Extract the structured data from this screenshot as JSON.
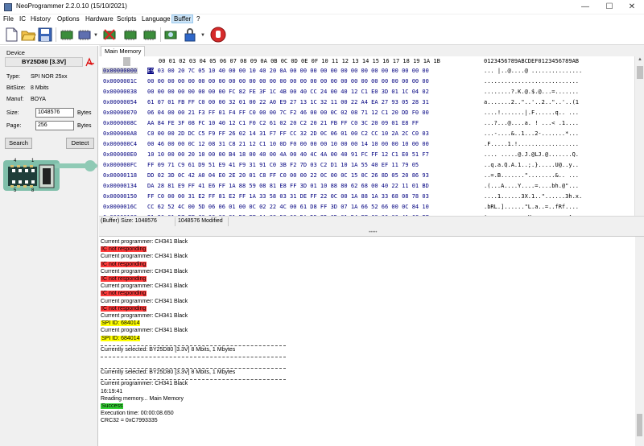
{
  "window": {
    "title": "NeoProgrammer 2.2.0.10 (15/10/2021)",
    "controls": [
      "—",
      "☐",
      "✕"
    ]
  },
  "menu": [
    "File",
    "IC",
    "History",
    "Options",
    "Hardware",
    "Scripts",
    "Language",
    "Buffer",
    "?"
  ],
  "menu_selected": "Buffer",
  "toolbar_icons": [
    "new-file-icon",
    "open-folder-icon",
    "save-icon",
    "read-chip-icon",
    "chip-dropdown-icon",
    "erase-chip-icon",
    "write-chip-icon",
    "verify-chip-icon",
    "auto-chip-icon",
    "lock-icon",
    "stop-icon"
  ],
  "device": {
    "group_title": "Device",
    "name": "BY25D80 [3.3V]",
    "type_label": "Type:",
    "type_value": "SPI NOR  25xx",
    "bitsize_label": "BitSize:",
    "bitsize_value": "8 Mbits",
    "manuf_label": "Manuf:",
    "manuf_value": "BOYA",
    "size_label": "Size:",
    "size_value": "1048576",
    "size_unit": "Bytes",
    "page_label": "Page:",
    "page_value": "256",
    "page_unit": "Bytes",
    "search_label": "Search",
    "detect_label": "Detect",
    "chip_pins_top": "4",
    "chip_pins_top2": "1",
    "chip_pins_bottom": "5",
    "chip_pins_bottom2": "8"
  },
  "tab": "Main Memory",
  "hex": {
    "header_cols": "00 01 02 03 04 05 06 07 08 09 0A 0B 0C 0D 0E 0F 10 11 12 13 14 15 16 17 18 19 1A 1B",
    "header_ascii": "0123456789ABCDEF0123456789AB",
    "rows": [
      {
        "addr": "0x00000000",
        "first": "E9",
        "bytes": " 03 00 20 7C 05 10 40 00 00 10 40 20 0A 00 00 00 00 00 00 00 00 00 00 00 00 00 00",
        "ascii": "... |..@....@ ..............."
      },
      {
        "addr": "0x0000001C",
        "first": "",
        "bytes": "00 00 00 00 00 00 00 00 00 00 00 00 00 00 00 00 00 00 00 00 00 00 00 00 00 00 00 00",
        "ascii": "............................"
      },
      {
        "addr": "0x00000038",
        "first": "",
        "bytes": "00 00 00 00 00 00 00 00 FC 82 FE 3F 1C 4B 00 40 CC 24 00 40 12 C1 E0 3D 01 1C 04 02",
        "ascii": "........?.K.@.$.@...=......."
      },
      {
        "addr": "0x00000054",
        "first": "",
        "bytes": "61 07 01 FB FF C0 00 00 32 01 00 22 A0 E9 27 13 1C 32 11 00 22 A4 EA 27 93 05 28 31",
        "ascii": "a.......2..\"..'..2..\"..'..(1"
      },
      {
        "addr": "0x00000070",
        "first": "",
        "bytes": "06 04 00 00 21 F3 FF 01 F4 FF C0 00 00 7C F2 46 00 00 0C 02 08 71 12 C1 20 DD F0 00",
        "ascii": "....!.......|.F......q.. ..."
      },
      {
        "addr": "0x0000008C",
        "first": "",
        "bytes": "AA 84 FE 3F 08 FC 10 40 12 C1 F0 C2 61 02 20 C2 20 21 FB FF C0 3C 20 09 01 E8 FF",
        "ascii": "...?...@....a. ! ...< .1...."
      },
      {
        "addr": "0x000000A8",
        "first": "",
        "bytes": "C0 00 00 2D DC C5 F9 FF 26 02 14 31 F7 FF CC 32 2D 0C 06 01 00 C2 CC 10 2A 2C C0 03",
        "ascii": "...-....&..1...2-.......*..."
      },
      {
        "addr": "0x000000C4",
        "first": "",
        "bytes": "00 46 00 00 0C 12 08 31 C8 21 12 C1 10 0D F0 00 00 00 10 00 00 14 10 00 00 10 00 00",
        "ascii": ".F.....1.!.................."
      },
      {
        "addr": "0x000000E0",
        "first": "",
        "bytes": "10 10 00 00 20 10 00 00 B4 18 00 40 00 4A 00 40 4C 4A 00 40 91 FC FF 12 C1 E0 51 F7",
        "ascii": ".... .....@.J.@LJ.@.......Q."
      },
      {
        "addr": "0x000000FC",
        "first": "",
        "bytes": "FF 09 71 C9 61 D9 51 E9 41 F9 31 91 C0 3B F2 7D 03 C2 D1 10 1A 55 40 EF 11 79 05",
        "ascii": "..q.a.Q.A.1..;.}.....U@..y.."
      },
      {
        "addr": "0x00000118",
        "first": "",
        "bytes": "DD 02 3D 0C 42 A0 04 E0 2E 20 01 C8 FF C0 00 00 22 0C 00 0C 15 0C 26 8D 05 20 86 93",
        "ascii": "..=.B.......\"........&.. ..."
      },
      {
        "addr": "0x00000134",
        "first": "",
        "bytes": "DA 28 81 E9 FF 41 E6 FF 1A 88 59 08 81 E8 FF 3D 01 10 88 80 62 68 00 40 22 11 01 BD",
        "ascii": ".(...A....Y....=....bh.@\"..."
      },
      {
        "addr": "0x00000150",
        "first": "",
        "bytes": "FF C0 00 00 31 E2 FF 81 E2 FF 1A 33 58 03 31 DE FF 22 0C 00 1A 88 1A 33 68 08 78 03",
        "ascii": "....1......3X.1..\"......3h.x."
      },
      {
        "addr": "0x0000016C",
        "first": "",
        "bytes": "CC 62 52 4C 00 5D 06 06 01 00 0C 02 22 4C 00 61 D8 FF 3D 07 1A 66 52 66 00 0C 84 10",
        "ascii": ".bRL.]......\"L.a..=..fRf...."
      },
      {
        "addr": "0x00000188",
        "first": "",
        "bytes": "21 20 01 D7 FF C0 00 00 81 D3 FF 1A 88 58 08 DA D5 2D 0D 01 D4 FF C0 00 00 41 CC FF",
        "ascii": "! ...........X...-.......A.."
      },
      {
        "addr": "0x000001A4",
        "first": "",
        "bytes": "10 31 20 40 2D 11 01 D1 FF C0 00 00 2D 0F 01 CE FF C0 00 00 2D 0E 3D 0C 0C 44 01 CC",
        "ascii": ".1 @-.......-.......-.=..D.."
      },
      {
        "addr": "0x000001C0",
        "first": "",
        "bytes": "FF C0 00 00 1B BB 27 BB 01 C6 E1 FF 2D 0C 0C 84 3D 02 41 C4 FF 1A 22 20 A2 20 81 C3",
        "ascii": "......'.....-...=.A..\" . .."
      }
    ]
  },
  "status": {
    "buffer_size": "(Buffer) Size: 1048576",
    "modified": "1048576 Modified"
  },
  "log": [
    {
      "text": "Current programmer: CH341 Black"
    },
    {
      "text": "IC not responding",
      "hl": "red"
    },
    {
      "text": "Current programmer: CH341 Black"
    },
    {
      "text": "IC not responding",
      "hl": "red"
    },
    {
      "text": "Current programmer: CH341 Black"
    },
    {
      "text": "IC not responding",
      "hl": "red"
    },
    {
      "text": "Current programmer: CH341 Black"
    },
    {
      "text": "IC not responding",
      "hl": "red"
    },
    {
      "text": "Current programmer: CH341 Black"
    },
    {
      "text": "IC not responding",
      "hl": "red"
    },
    {
      "text": "Current programmer: CH341 Black"
    },
    {
      "text": "SPI ID: 684014",
      "hl": "yellow"
    },
    {
      "text": "Current programmer: CH341 Black"
    },
    {
      "text": "SPI ID: 684014",
      "hl": "yellow"
    },
    {
      "sep": true
    },
    {
      "text": "Currently selected:  BY25D80 [3.3V] 8 Mbits, 1 Mbytes"
    },
    {
      "sep": true
    },
    {
      "text": ""
    },
    {
      "sep": true
    },
    {
      "text": "Currently selected:  BY25D80 [3.3V] 8 Mbits, 1 Mbytes"
    },
    {
      "sep": true
    },
    {
      "text": "Current programmer: CH341 Black"
    },
    {
      "text": "16:19:41"
    },
    {
      "text": "Reading memory... Main Memory"
    },
    {
      "text": "Success",
      "hl": "green"
    },
    {
      "text": "Execution time: 00:00:08.650"
    },
    {
      "text": "CRC32 = 0xC7993335"
    }
  ]
}
